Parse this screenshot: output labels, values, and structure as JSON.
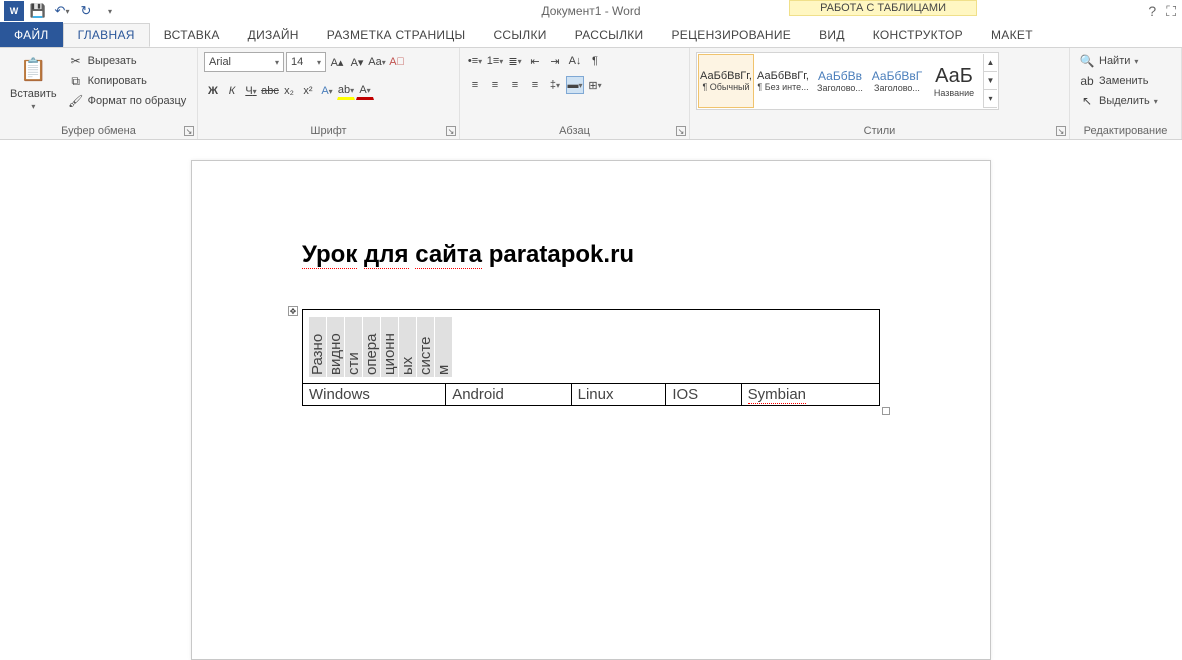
{
  "title": "Документ1 - Word",
  "context_title": "РАБОТА С ТАБЛИЦАМИ",
  "tabs": {
    "file": "ФАЙЛ",
    "home": "ГЛАВНАЯ",
    "insert": "ВСТАВКА",
    "design": "ДИЗАЙН",
    "layout": "РАЗМЕТКА СТРАНИЦЫ",
    "refs": "ССЫЛКИ",
    "mail": "РАССЫЛКИ",
    "review": "РЕЦЕНЗИРОВАНИЕ",
    "view": "ВИД",
    "ctx_design": "КОНСТРУКТОР",
    "ctx_layout": "МАКЕТ"
  },
  "groups": {
    "clipboard": "Буфер обмена",
    "font": "Шрифт",
    "paragraph": "Абзац",
    "styles": "Стили",
    "editing": "Редактирование"
  },
  "clipboard": {
    "paste": "Вставить",
    "cut": "Вырезать",
    "copy": "Копировать",
    "format_painter": "Формат по образцу"
  },
  "font": {
    "name": "Arial",
    "size": "14"
  },
  "styles_list": [
    {
      "preview": "АаБбВвГг,",
      "name": "¶ Обычный"
    },
    {
      "preview": "АаБбВвГг,",
      "name": "¶ Без инте..."
    },
    {
      "preview": "АаБбВв",
      "name": "Заголово..."
    },
    {
      "preview": "АаБбВвГ",
      "name": "Заголово..."
    },
    {
      "preview": "АаБ",
      "name": "Название"
    }
  ],
  "editing": {
    "find": "Найти",
    "replace": "Заменить",
    "select": "Выделить"
  },
  "document": {
    "heading_u1": "Урок",
    "heading_u2": "для",
    "heading_u3": "сайта",
    "heading_plain": " paratapok.ru",
    "table_header": [
      "Разно",
      "видно",
      "сти",
      "опера",
      "ционн",
      "ых",
      "систе",
      "м"
    ],
    "row2": [
      "Windows",
      "Android",
      "Linux",
      "IOS",
      "Symbian"
    ]
  }
}
